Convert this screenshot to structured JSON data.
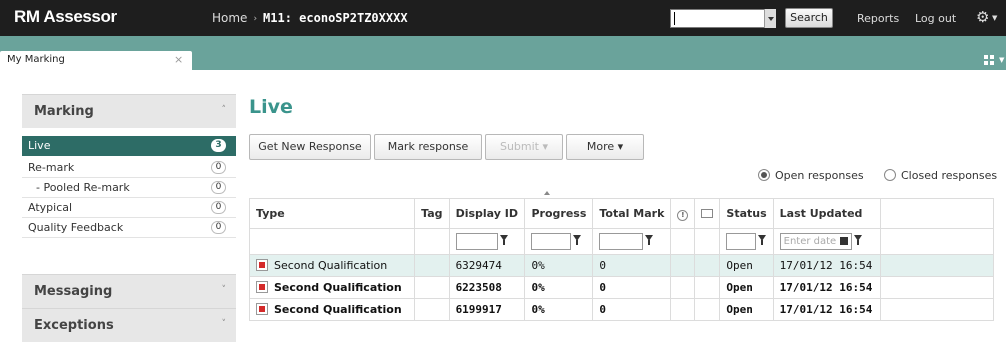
{
  "app": {
    "logo": "RM Assessor"
  },
  "breadcrumb": {
    "home": "Home",
    "separator": "›",
    "current": "M11: econoSP2TZ0XXXX"
  },
  "top": {
    "search_value": "",
    "search_label": "Search",
    "reports": "Reports",
    "logout": "Log out",
    "gear_icon": "gear-icon"
  },
  "tabs": [
    {
      "label": "My Marking",
      "close": "×"
    }
  ],
  "sidebar": {
    "marking": {
      "title": "Marking",
      "chevron": "˄"
    },
    "items": [
      {
        "label": "Live",
        "count": "3",
        "active": true
      },
      {
        "label": "Re-mark",
        "count": "0"
      },
      {
        "label": "- Pooled Re-mark",
        "count": "0"
      },
      {
        "label": "Atypical",
        "count": "0"
      },
      {
        "label": "Quality Feedback",
        "count": "0"
      }
    ],
    "messaging": {
      "title": "Messaging",
      "chevron": "˅"
    },
    "exceptions": {
      "title": "Exceptions",
      "chevron": "˅"
    }
  },
  "main": {
    "title": "Live",
    "buttons": {
      "get_new": "Get New Response",
      "mark": "Mark response",
      "submit": "Submit",
      "submit_caret": "▾",
      "more": "More",
      "more_caret": "▾"
    },
    "radios": {
      "open": "Open responses",
      "closed": "Closed responses",
      "selected": "open"
    },
    "columns": [
      "Type",
      "Tag",
      "Display ID",
      "Progress",
      "Total Mark",
      "",
      "",
      "Status",
      "Last Updated"
    ],
    "date_placeholder": "Enter date",
    "rows": [
      {
        "type": "Second Qualification",
        "tag": "",
        "display_id": "6329474",
        "progress": "0%",
        "total_mark": "0",
        "status": "Open",
        "last_updated": "17/01/12 16:54",
        "bold": false
      },
      {
        "type": "Second Qualification",
        "tag": "",
        "display_id": "6223508",
        "progress": "0%",
        "total_mark": "0",
        "status": "Open",
        "last_updated": "17/01/12 16:54",
        "bold": true
      },
      {
        "type": "Second Qualification",
        "tag": "",
        "display_id": "6199917",
        "progress": "0%",
        "total_mark": "0",
        "status": "Open",
        "last_updated": "17/01/12 16:54",
        "bold": true
      }
    ]
  }
}
